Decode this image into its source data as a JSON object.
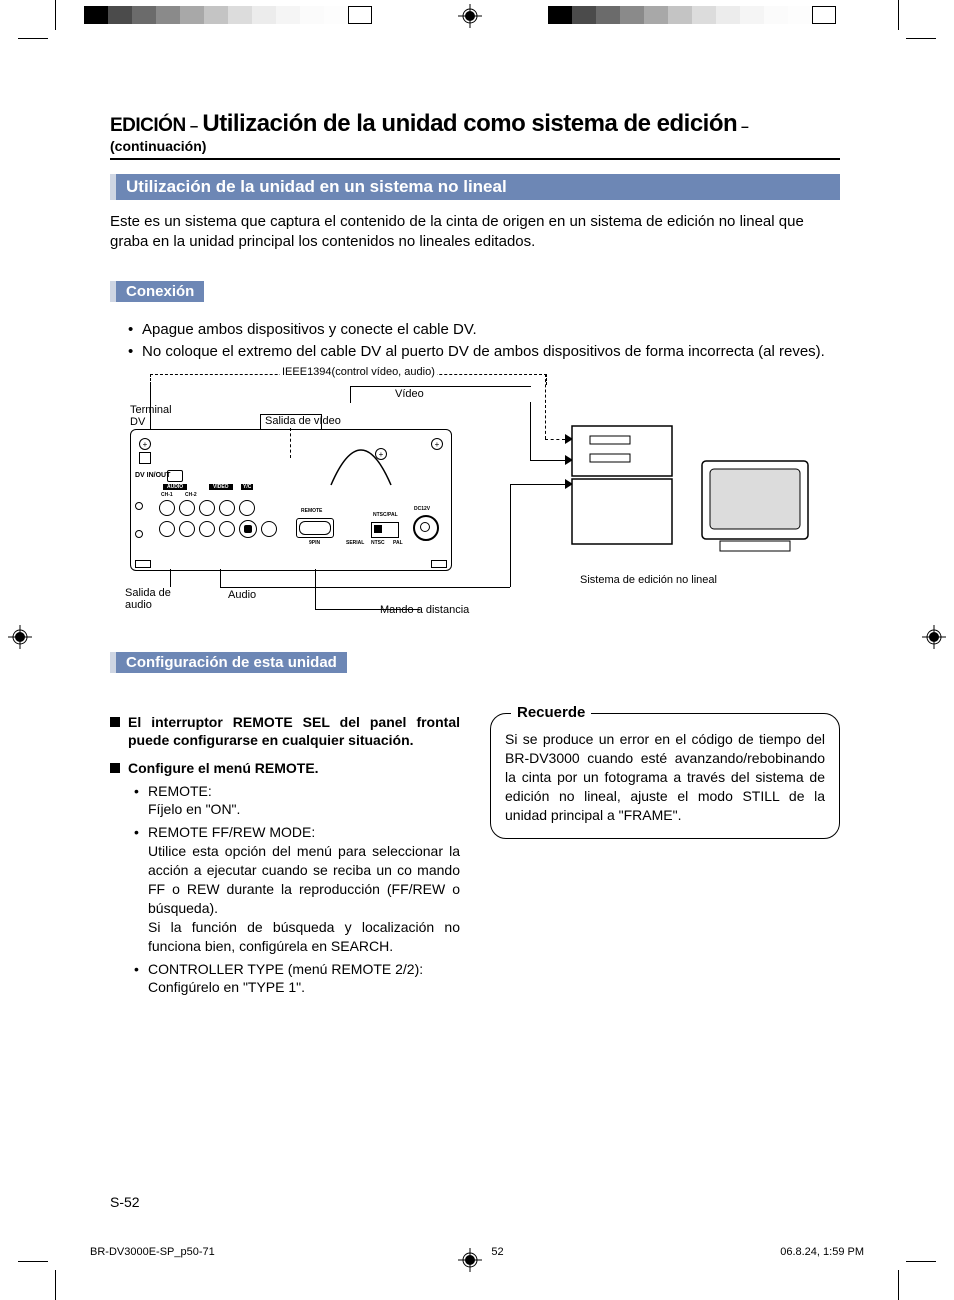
{
  "header": {
    "prefix": "EDICIÓN",
    "separator": " – ",
    "main": "Utilización de la unidad como sistema de edición",
    "suffix": " – (continuación)"
  },
  "section_bar": "Utilización de la unidad en un sistema no lineal",
  "intro": "Este es un sistema que captura el contenido de la cinta de origen en un sistema de edición no lineal que graba en la unidad principal los contenidos no lineales editados.",
  "connection": {
    "title": "Conexión",
    "bullets": [
      "Apague ambos dispositivos y conecte el cable DV.",
      "No coloque el extremo del cable DV al puerto DV de ambos dispositivos de forma incorrecta (al reves)."
    ]
  },
  "diagram": {
    "ieee": "IEEE1394(control vídeo, audio)",
    "video": "Vídeo",
    "terminal_dv": "Terminal DV",
    "salida_video": "Salida de vídeo",
    "salida_audio": "Salida de audio",
    "audio": "Audio",
    "mando": "Mando a distancia",
    "sistema": "Sistema de edición no lineal",
    "panel": {
      "dv_inout": "DV IN/OUT",
      "audio_lbl": "AUDIO",
      "video_lbl": "VIDEO",
      "ch1": "CH-1",
      "ch2": "CH-2",
      "yc": "Y/C",
      "remote": "REMOTE",
      "serial": "SERIAL",
      "ntsc_pal": "NTSC/PAL",
      "ntsc": "NTSC",
      "pal": "PAL",
      "nine_pin": "9PIN",
      "dc12v": "DC12V"
    }
  },
  "config": {
    "title": "Configuración de esta unidad",
    "sq1": "El interruptor REMOTE SEL del panel frontal puede configurarse en cualquier situación.",
    "sq2": "Configure el menú REMOTE.",
    "items": [
      {
        "head": "REMOTE:",
        "body": "Fíjelo en \"ON\"."
      },
      {
        "head": "REMOTE FF/REW MODE:",
        "body": "Utilice esta opción del menú para seleccionar la acción a ejecutar cuando se reciba un co mando FF o REW durante la reproducción (FF/REW o búsqueda).",
        "body2": "Si la función de búsqueda y localización no funciona bien, configúrela en SEARCH."
      },
      {
        "head": "CONTROLLER TYPE (menú REMOTE 2/2):",
        "body": "Configúrelo en \"TYPE 1\"."
      }
    ]
  },
  "remember": {
    "title": "Recuerde",
    "body": "Si se produce un error en el código de tiempo del BR-DV3000 cuando esté avanzando/rebobinando la cinta por un fotograma a través del sistema de edición no lineal, ajuste el modo STILL de la unidad principal a \"FRAME\"."
  },
  "page_num": "S-52",
  "footer": {
    "left": "BR-DV3000E-SP_p50-71",
    "center": "52",
    "right": "06.8.24, 1:59 PM"
  }
}
